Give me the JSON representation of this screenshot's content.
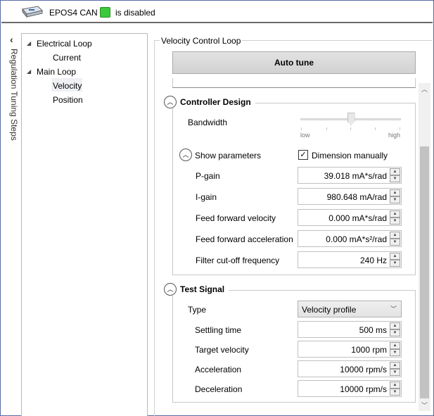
{
  "header": {
    "device_name": "EPOS4 CAN",
    "status_text": "is disabled",
    "status_color": "#3cc93a"
  },
  "steps_panel": {
    "label": "Regulation Tuning Steps",
    "collapse_glyph": "‹"
  },
  "tree": {
    "items": [
      {
        "label": "Electrical Loop",
        "expanded": true
      },
      {
        "label": "Current"
      },
      {
        "label": "Main Loop",
        "expanded": true
      },
      {
        "label": "Velocity",
        "selected": true
      },
      {
        "label": "Position"
      }
    ]
  },
  "main": {
    "title": "Velocity Control Loop",
    "auto_tune_label": "Auto tune",
    "controller_design": {
      "title": "Controller Design",
      "bandwidth_label": "Bandwidth",
      "bandwidth_level": 0.5,
      "low_label": "low",
      "high_label": "high",
      "show_params_label": "Show parameters",
      "dimension_label": "Dimension manually",
      "dimension_checked": true,
      "params": [
        {
          "label": "P-gain",
          "value": "39.018 mA*s/rad"
        },
        {
          "label": "I-gain",
          "value": "980.648 mA/rad"
        },
        {
          "label": "Feed forward velocity",
          "value": "0.000 mA*s/rad"
        },
        {
          "label": "Feed forward acceleration",
          "value": "0.000 mA*s²/rad"
        },
        {
          "label": "Filter cut-off frequency",
          "value": "240 Hz"
        }
      ]
    },
    "test_signal": {
      "title": "Test Signal",
      "type_label": "Type",
      "type_value": "Velocity profile",
      "params": [
        {
          "label": "Settling time",
          "value": "500 ms"
        },
        {
          "label": "Target velocity",
          "value": "1000 rpm"
        },
        {
          "label": "Acceleration",
          "value": "10000 rpm/s"
        },
        {
          "label": "Deceleration",
          "value": "10000 rpm/s"
        }
      ]
    }
  },
  "icons": {
    "expanded_arrow": "◢",
    "collapse_circle": "︿",
    "spin_up": "▲",
    "spin_down": "▼",
    "scroll_up": "︿",
    "scroll_down": "﹀",
    "dropdown_chevron": "﹀",
    "check": "✓"
  }
}
